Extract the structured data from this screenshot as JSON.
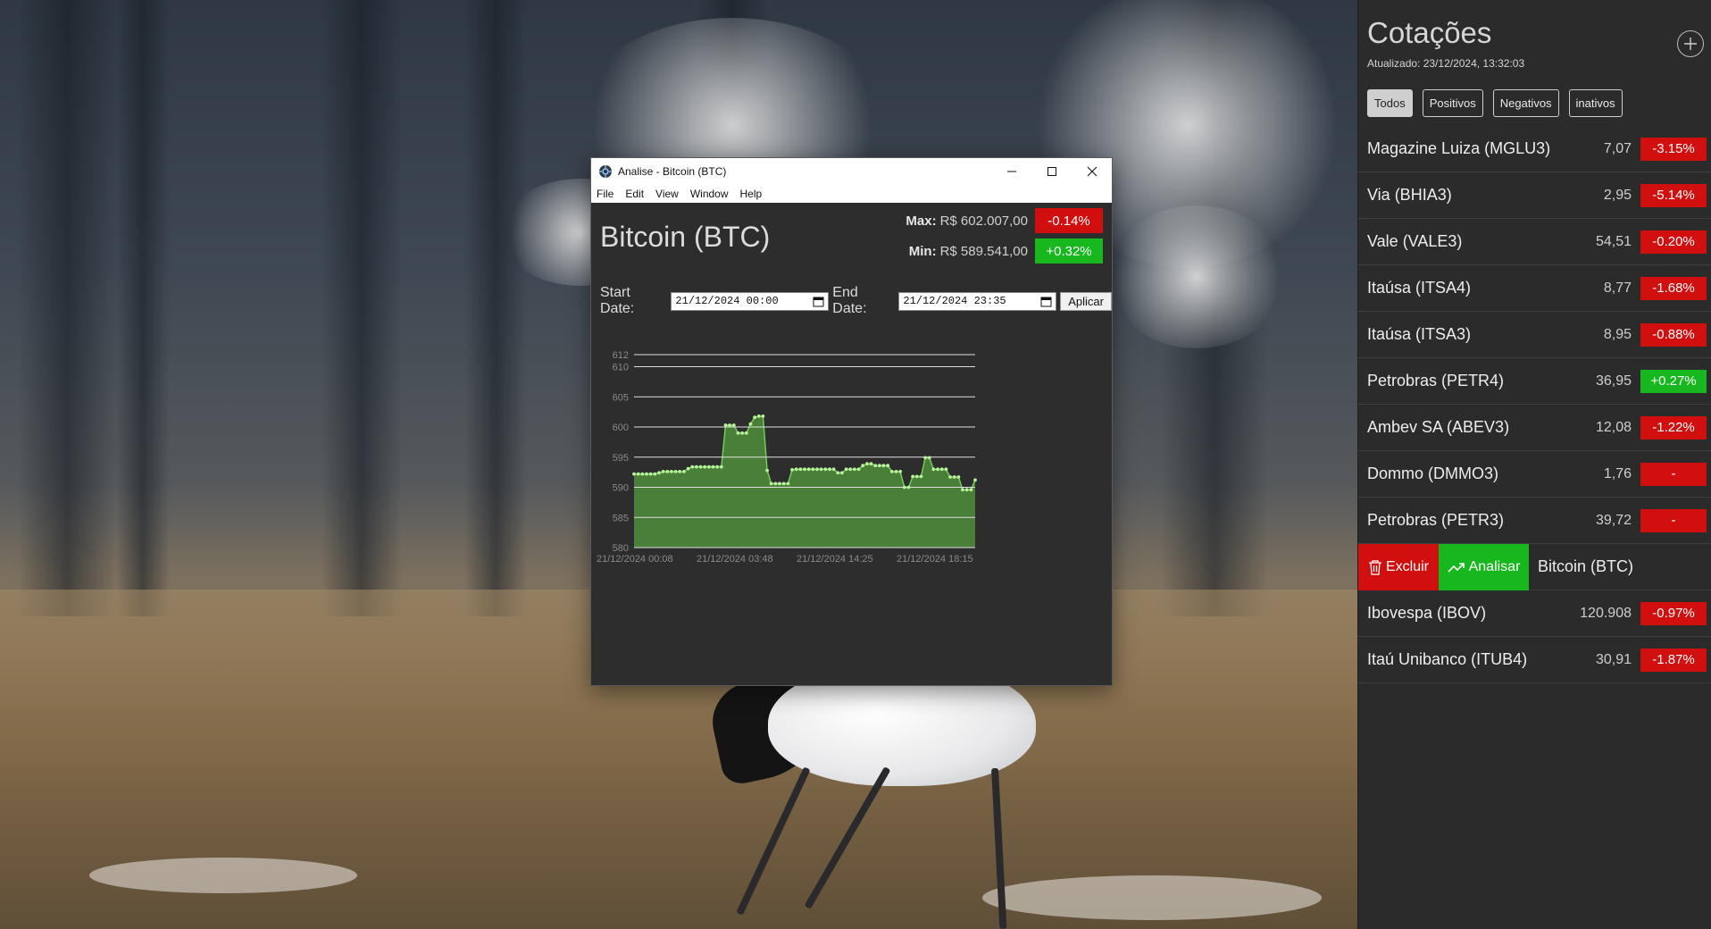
{
  "window": {
    "title": "Analise - Bitcoin (BTC)",
    "menu": [
      "File",
      "Edit",
      "View",
      "Window",
      "Help"
    ],
    "asset_title": "Bitcoin (BTC)",
    "max_label": "Max:",
    "max_value": "R$ 602.007,00",
    "max_change": "-0.14%",
    "min_label": "Min:",
    "min_value": "R$ 589.541,00",
    "min_change": "+0.32%",
    "start_label": "Start Date:",
    "start_value": "21/12/2024 00:00",
    "end_label": "End Date:",
    "end_value": "21/12/2024 23:35",
    "apply_label": "Aplicar",
    "colors": {
      "negative": "#d10f0f",
      "positive": "#16b81d",
      "area": "#4a7f3a",
      "point": "#b8f29a"
    }
  },
  "chart_data": {
    "type": "area",
    "title": "",
    "xlabel": "",
    "ylabel": "",
    "ylim": [
      580,
      612
    ],
    "y_ticks": [
      580,
      585,
      590,
      595,
      600,
      605,
      610,
      612
    ],
    "x_ticks": [
      "21/12/2024 00:08",
      "21/12/2024 03:48",
      "21/12/2024 14:25",
      "21/12/2024 18:15"
    ],
    "grid": true,
    "legend": "none",
    "values": [
      592.2,
      592.2,
      592.2,
      592.2,
      592.2,
      592.2,
      592.4,
      592.6,
      592.6,
      592.6,
      592.6,
      592.6,
      592.6,
      593.1,
      593.4,
      593.4,
      593.4,
      593.4,
      593.4,
      593.4,
      593.4,
      593.4,
      600.3,
      600.3,
      600.3,
      599.0,
      599.0,
      599.0,
      600.5,
      601.6,
      601.8,
      601.8,
      592.8,
      590.6,
      590.6,
      590.6,
      590.6,
      590.6,
      592.9,
      593.0,
      593.0,
      593.0,
      593.0,
      593.0,
      593.0,
      593.0,
      593.0,
      593.0,
      593.0,
      592.4,
      592.4,
      593.0,
      593.0,
      593.0,
      593.0,
      593.6,
      593.9,
      593.9,
      593.6,
      593.6,
      593.6,
      593.6,
      592.6,
      592.6,
      592.6,
      590.0,
      590.0,
      591.8,
      591.8,
      591.8,
      594.9,
      594.9,
      593.0,
      593.0,
      593.0,
      593.0,
      591.7,
      591.7,
      591.7,
      589.6,
      589.6,
      589.6,
      591.2
    ]
  },
  "panel": {
    "title": "Cotações",
    "updated": "Atualizado: 23/12/2024, 13:32:03",
    "filters": [
      "Todos",
      "Positivos",
      "Negativos",
      "inativos"
    ],
    "quotes_top": [
      {
        "name": "Magazine Luiza (MGLU3)",
        "value": "7,07",
        "change": "-3.15%",
        "color": "#d10f0f"
      },
      {
        "name": "Via (BHIA3)",
        "value": "2,95",
        "change": "-5.14%",
        "color": "#d10f0f"
      },
      {
        "name": "Vale (VALE3)",
        "value": "54,51",
        "change": "-0.20%",
        "color": "#d10f0f"
      },
      {
        "name": "Itaúsa (ITSA4)",
        "value": "8,77",
        "change": "-1.68%",
        "color": "#d10f0f"
      },
      {
        "name": "Itaúsa (ITSA3)",
        "value": "8,95",
        "change": "-0.88%",
        "color": "#d10f0f"
      },
      {
        "name": "Petrobras (PETR4)",
        "value": "36,95",
        "change": "+0.27%",
        "color": "#16b81d"
      },
      {
        "name": "Ambev SA (ABEV3)",
        "value": "12,08",
        "change": "-1.22%",
        "color": "#d10f0f"
      },
      {
        "name": "Dommo (DMMO3)",
        "value": "1,76",
        "change": "-",
        "color": "#d10f0f"
      },
      {
        "name": "Petrobras (PETR3)",
        "value": "39,72",
        "change": "-",
        "color": "#d10f0f"
      }
    ],
    "action_row": {
      "delete_label": "Excluir",
      "analyze_label": "Analisar",
      "name": "Bitcoin (BTC)"
    },
    "quotes_bottom": [
      {
        "name": "Ibovespa (IBOV)",
        "value": "120.908",
        "change": "-0.97%",
        "color": "#d10f0f"
      },
      {
        "name": "Itaú Unibanco (ITUB4)",
        "value": "30,91",
        "change": "-1.87%",
        "color": "#d10f0f"
      }
    ]
  }
}
